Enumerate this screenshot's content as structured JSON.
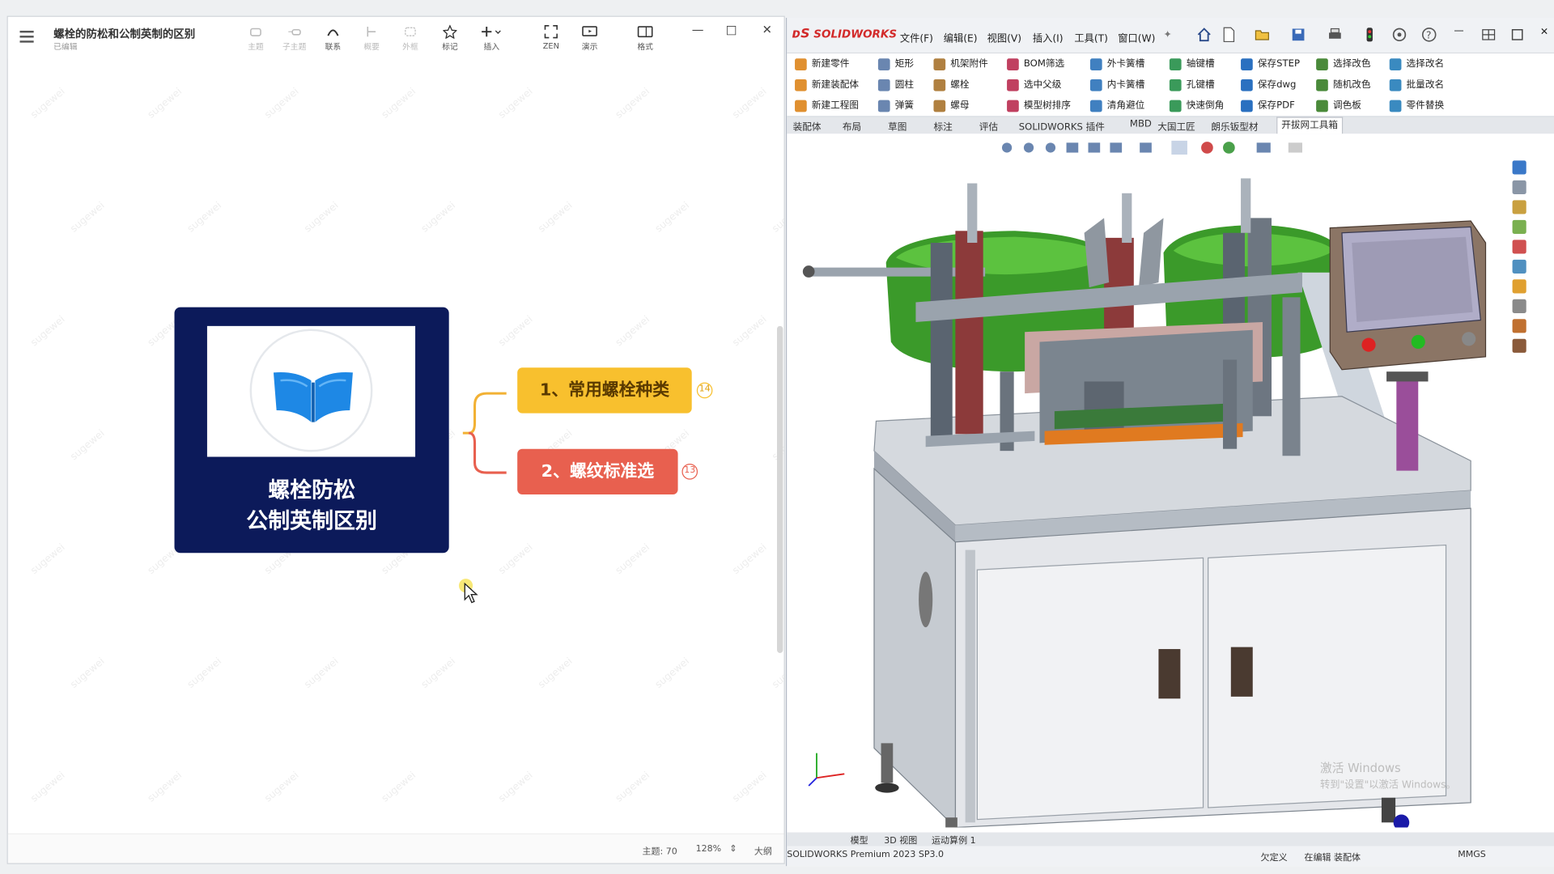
{
  "mindmap": {
    "title": "螺栓的防松和公制英制的区别",
    "subtitle": "已编辑",
    "toolbar": [
      "主题",
      "子主题",
      "联系",
      "概要",
      "外框",
      "标记",
      "插入",
      "ZEN",
      "演示",
      "格式"
    ],
    "root": {
      "line1": "螺栓防松",
      "line2": "公制英制区别"
    },
    "nodes": [
      {
        "label": "1、常用螺栓种类",
        "count": "14"
      },
      {
        "label": "2、螺纹标准选",
        "count": "13"
      }
    ],
    "watermark": "sugewei",
    "status": {
      "topics": "主题: 70",
      "zoom": "128%",
      "outline": "大纲"
    }
  },
  "solidworks": {
    "logo": "SOLIDWORKS",
    "menu": [
      "文件(F)",
      "编辑(E)",
      "视图(V)",
      "插入(I)",
      "工具(T)",
      "窗口(W)"
    ],
    "ribbon": [
      [
        "新建零件",
        "新建装配体",
        "新建工程图"
      ],
      [
        "矩形",
        "圆柱",
        "弹簧"
      ],
      [
        "机架附件",
        "螺栓",
        "螺母"
      ],
      [
        "BOM筛选",
        "选中父级",
        "模型树排序"
      ],
      [
        "外卡簧槽",
        "内卡簧槽",
        "清角避位"
      ],
      [
        "轴键槽",
        "孔键槽",
        "快速倒角"
      ],
      [
        "保存STEP",
        "保存dwg",
        "保存PDF"
      ],
      [
        "选择改色",
        "随机改色",
        "调色板"
      ],
      [
        "选择改名",
        "批量改名",
        "零件替换"
      ]
    ],
    "tabs": [
      "装配体",
      "布局",
      "草图",
      "标注",
      "评估",
      "SOLIDWORKS 插件",
      "MBD",
      "大国工匠",
      "朗乐钣型材",
      "开拔网工具箱"
    ],
    "bottom_tabs": [
      "模型",
      "3D 视图",
      "运动算例 1"
    ],
    "status": {
      "product": "SOLIDWORKS Premium 2023 SP3.0",
      "defined": "欠定义",
      "editing": "在编辑 装配体",
      "units": "MMGS"
    },
    "activate": {
      "line1": "激活 Windows",
      "line2": "转到\"设置\"以激活 Windows。"
    }
  }
}
